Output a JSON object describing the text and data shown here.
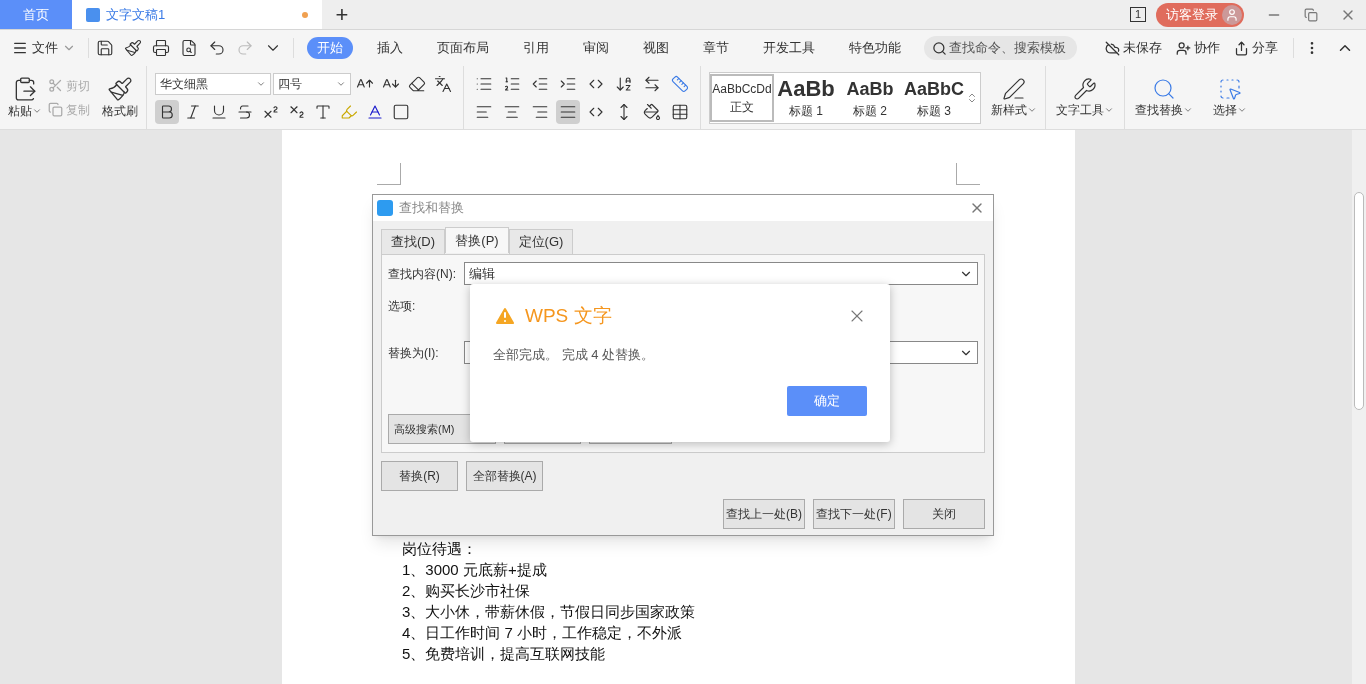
{
  "title_bar": {
    "home_tab": "首页",
    "document_tab": {
      "title": "文字文稿1",
      "unsaved": true
    },
    "new_tab": "+",
    "page_count": "1",
    "login": "访客登录"
  },
  "menu_bar": {
    "file": "文件",
    "tabs": [
      {
        "label": "开始",
        "selected": true
      },
      {
        "label": "插入",
        "selected": false
      },
      {
        "label": "页面布局",
        "selected": false
      },
      {
        "label": "引用",
        "selected": false
      },
      {
        "label": "审阅",
        "selected": false
      },
      {
        "label": "视图",
        "selected": false
      },
      {
        "label": "章节",
        "selected": false
      },
      {
        "label": "开发工具",
        "selected": false
      },
      {
        "label": "特色功能",
        "selected": false
      }
    ],
    "search": {
      "placeholder": "查找命令、搜索模板"
    },
    "actions": [
      "未保存",
      "协作",
      "分享"
    ]
  },
  "ribbon": {
    "paste": "粘贴",
    "clipboard": [
      {
        "label": "剪切",
        "disabled": true
      },
      {
        "label": "复制",
        "disabled": true
      }
    ],
    "format_painter": "格式刷",
    "font": {
      "family": "华文细黑",
      "size": "四号",
      "bold_on": true
    },
    "justify_on": true,
    "styles": [
      {
        "preview": "AaBbCcDd",
        "label": "正文",
        "selected": true
      },
      {
        "preview": "AaBb",
        "label": "标题 1",
        "selected": false
      },
      {
        "preview": "AaBb",
        "label": "标题 2",
        "selected": false
      },
      {
        "preview": "AaBbC",
        "label": "标题 3",
        "selected": false
      }
    ],
    "new_style": "新样式",
    "tools": [
      "文字工具",
      "查找替换",
      "选择"
    ]
  },
  "document": {
    "lines": [
      "岗位待遇：",
      "1、3000 元底薪+提成",
      "2、购买长沙市社保",
      "3、大小休，带薪休假，节假日同步国家政策",
      "4、日工作时间 7 小时，工作稳定，不外派",
      "5、免费培训，提高互联网技能"
    ]
  },
  "find_replace_dialog": {
    "title": "查找和替换",
    "tabs": [
      {
        "label": "查找(D)",
        "selected": false
      },
      {
        "label": "替换(P)",
        "selected": true
      },
      {
        "label": "定位(G)",
        "selected": false
      }
    ],
    "find_label": "查找内容(N):",
    "find_value": "编辑",
    "options_label": "选项:",
    "replace_label": "替换为(I):",
    "advanced_search": "高级搜索(M)",
    "replace_buttons": [
      "替换(R)",
      "全部替换(A)"
    ],
    "nav_buttons": [
      "查找上一处(B)",
      "查找下一处(F)",
      "关闭"
    ]
  },
  "alert": {
    "title": "WPS 文字",
    "message": "全部完成。 完成 4 处替换。",
    "ok": "确定"
  }
}
